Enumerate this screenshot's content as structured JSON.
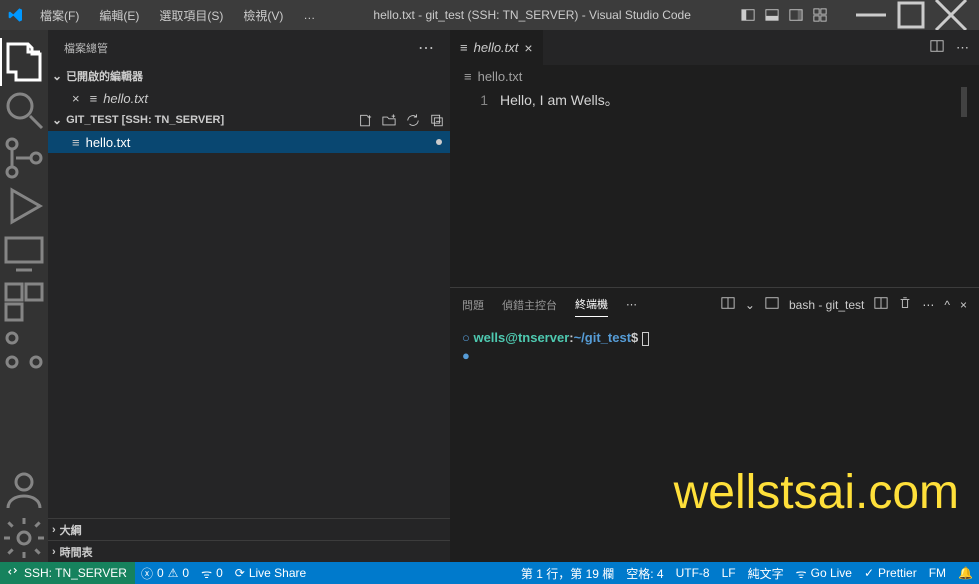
{
  "titlebar": {
    "menus": {
      "file": "檔案(F)",
      "edit": "編輯(E)",
      "selection": "選取項目(S)",
      "view": "檢視(V)",
      "more": "…"
    },
    "title": "hello.txt - git_test (SSH: TN_SERVER) - Visual Studio Code"
  },
  "sidebar": {
    "title": "檔案總管",
    "open_editors_label": "已開啟的編輯器",
    "open_editor_file": "hello.txt",
    "folder_label": "GIT_TEST [SSH: TN_SERVER]",
    "tree_file": "hello.txt",
    "outline": "大綱",
    "timeline": "時間表"
  },
  "tab": {
    "name": "hello.txt"
  },
  "breadcrumb": {
    "file": "hello.txt"
  },
  "editor": {
    "line_num": "1",
    "content": "Hello, I am Wells。"
  },
  "panel": {
    "tabs": {
      "problems": "問題",
      "debug": "偵錯主控台",
      "terminal": "終端機"
    },
    "shell_label": "bash - git_test",
    "prompt_user": "wells@tnserver",
    "prompt_colon": ":",
    "prompt_path": "~/git_test",
    "prompt_dollar": "$"
  },
  "watermark": "wellstsai.com",
  "statusbar": {
    "remote": "SSH: TN_SERVER",
    "errors": "0",
    "warnings": "0",
    "ports": "0",
    "liveshare": "Live Share",
    "cursor": "第 1 行，第 19 欄",
    "spaces": "空格: 4",
    "encoding": "UTF-8",
    "eol": "LF",
    "lang": "純文字",
    "golive": "Go Live",
    "prettier": "Prettier",
    "fm": "FM"
  }
}
